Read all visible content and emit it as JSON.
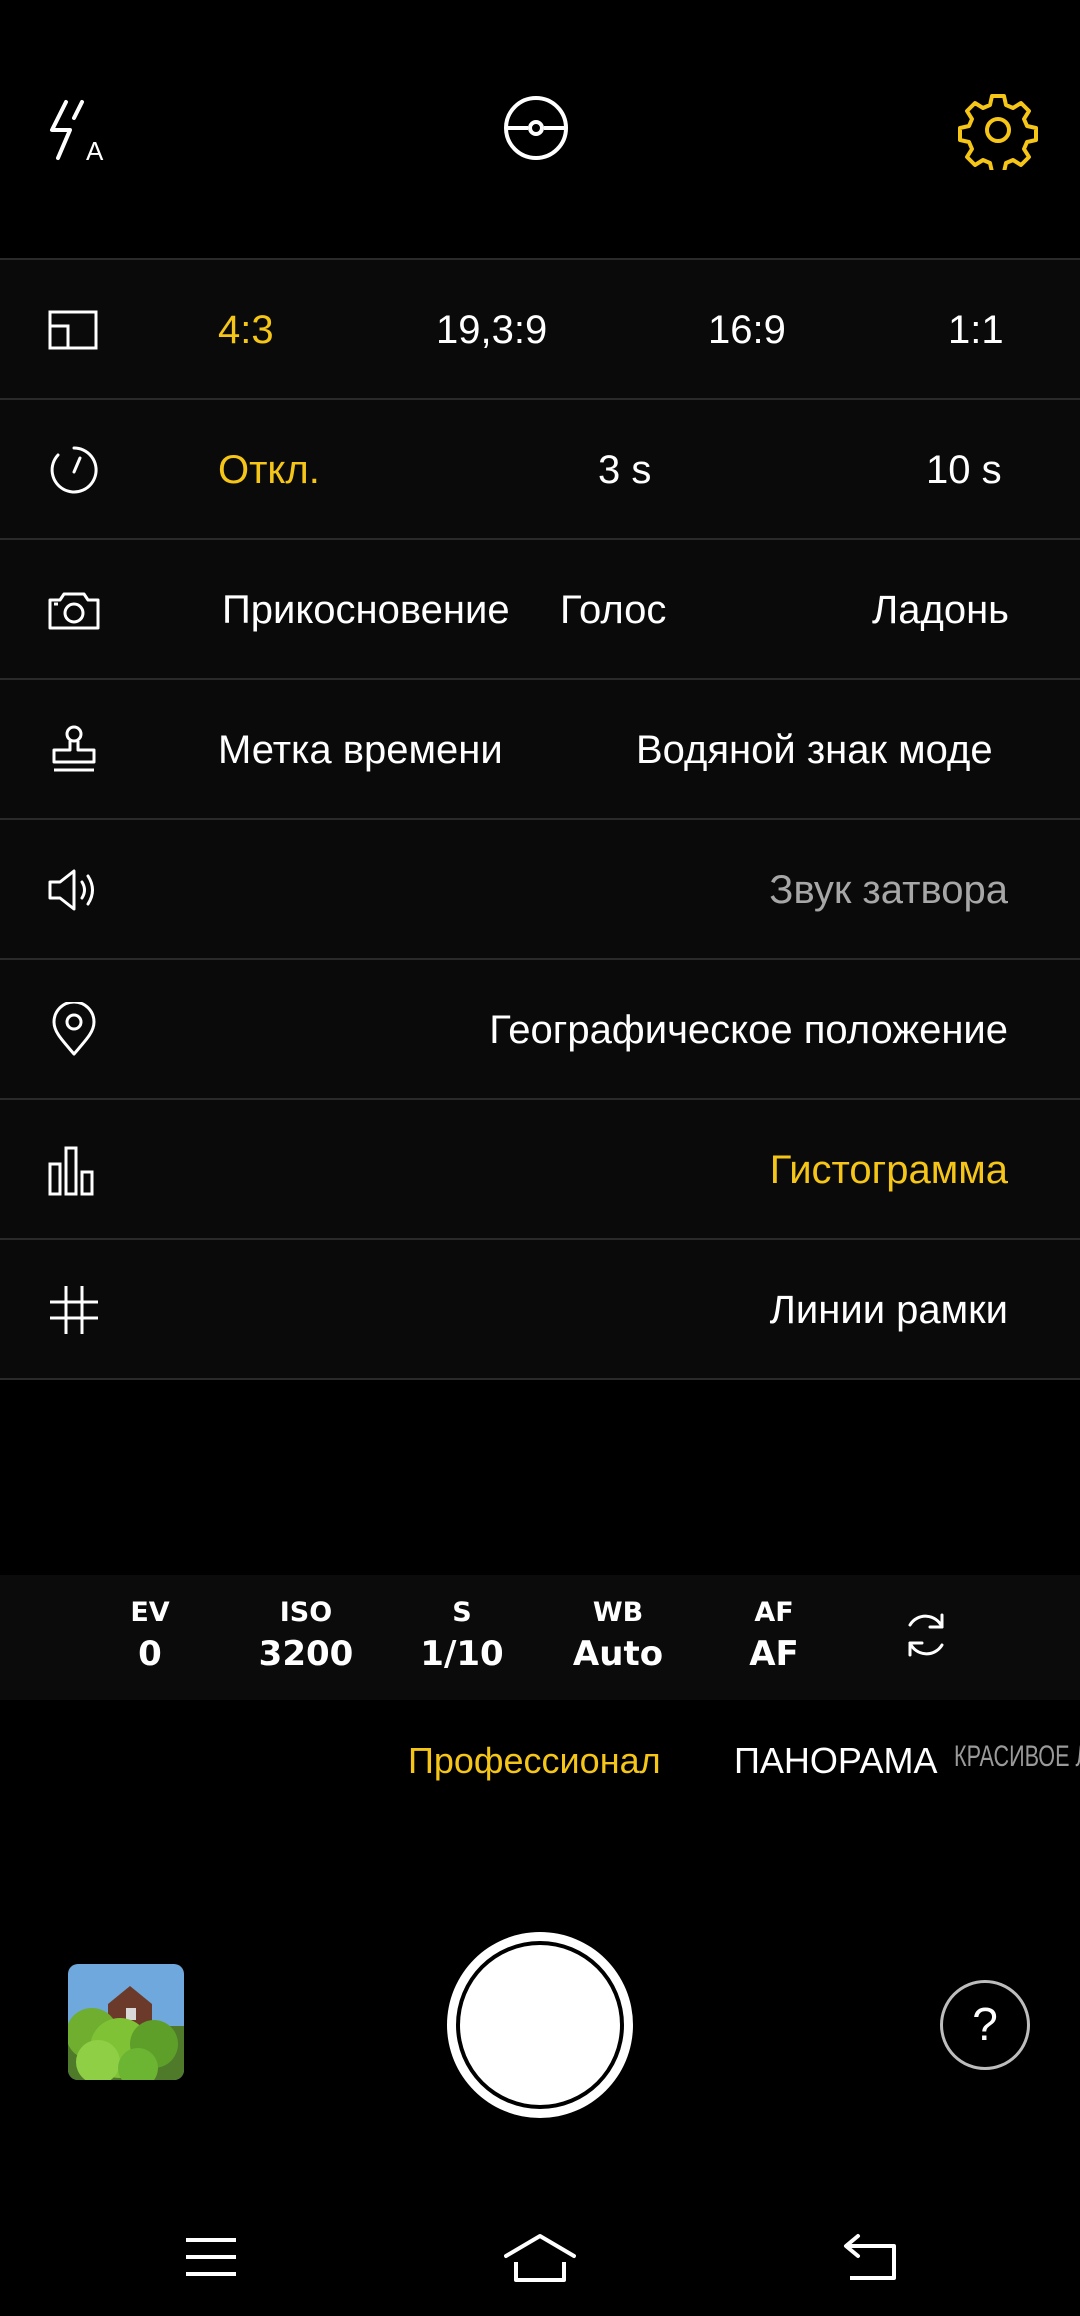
{
  "top_bar": {
    "icons": [
      "flash-auto-icon",
      "lens-switch-icon",
      "settings-gear-icon"
    ],
    "accent": "#f5c518"
  },
  "settings": {
    "aspect_ratio": {
      "icon": "aspect-ratio-icon",
      "options": [
        "4:3",
        "19,3:9",
        "16:9",
        "1:1"
      ],
      "selected": "4:3"
    },
    "timer": {
      "icon": "timer-icon",
      "options": [
        "Откл.",
        "3 s",
        "10 s"
      ],
      "selected": "Откл."
    },
    "capture_mode": {
      "icon": "camera-icon",
      "options": [
        "Прикосновение",
        "Голос",
        "Ладонь"
      ]
    },
    "watermark": {
      "icon": "stamp-icon",
      "options": [
        "Метка времени",
        "Водяной знак моде"
      ]
    },
    "shutter_sound": {
      "icon": "speaker-icon",
      "label": "Звук затвора"
    },
    "location": {
      "icon": "location-pin-icon",
      "label": "Географическое положение"
    },
    "histogram": {
      "icon": "histogram-icon",
      "label": "Гистограмма"
    },
    "grid": {
      "icon": "grid-icon",
      "label": "Линии рамки"
    }
  },
  "pro_controls": [
    {
      "label": "EV",
      "value": "0"
    },
    {
      "label": "ISO",
      "value": "3200"
    },
    {
      "label": "S",
      "value": "1/10"
    },
    {
      "label": "WB",
      "value": "Auto"
    },
    {
      "label": "AF",
      "value": "AF"
    }
  ],
  "modes": {
    "active": "Профессионал",
    "items": [
      "ПАНОРАМА",
      "КРАСИВОЕ ЛИЦО"
    ]
  },
  "bottom": {
    "help_label": "?"
  }
}
